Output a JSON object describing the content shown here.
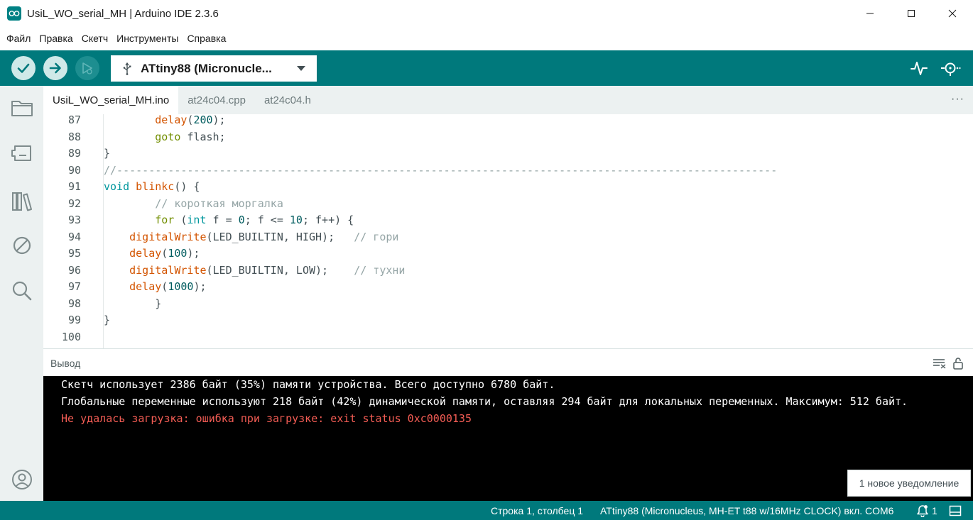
{
  "window": {
    "title": "UsiL_WO_serial_MH | Arduino IDE 2.3.6"
  },
  "menu": [
    "Файл",
    "Правка",
    "Скетч",
    "Инструменты",
    "Справка"
  ],
  "toolbar": {
    "board": "ATtiny88 (Micronucle...",
    "icons": [
      "verify-icon",
      "upload-icon",
      "debug-icon",
      "usb-icon",
      "chevron-down-icon",
      "serial-plotter-icon",
      "serial-monitor-icon"
    ]
  },
  "sidebar": {
    "icons": [
      "folder-icon",
      "boards-manager-icon",
      "library-icon",
      "debug-disabled-icon",
      "search-icon",
      "account-icon"
    ]
  },
  "tabs": {
    "items": [
      "UsiL_WO_serial_MH.ino",
      "at24c04.cpp",
      "at24c04.h"
    ],
    "active": "UsiL_WO_serial_MH.ino",
    "more": "···"
  },
  "editor": {
    "lines": [
      {
        "n": "87",
        "text": "        delay(200);"
      },
      {
        "n": "88",
        "text": "        goto flash;"
      },
      {
        "n": "89",
        "text": "}"
      },
      {
        "n": "90",
        "text": "//-------------------------------------------------------------------------------------------------------"
      },
      {
        "n": "91",
        "text": "void blinkc() {"
      },
      {
        "n": "92",
        "text": "        // короткая моргалка"
      },
      {
        "n": "93",
        "text": "        for (int f = 0; f <= 10; f++) {"
      },
      {
        "n": "94",
        "text": "    digitalWrite(LED_BUILTIN, HIGH);   // гори"
      },
      {
        "n": "95",
        "text": "    delay(100);"
      },
      {
        "n": "96",
        "text": "    digitalWrite(LED_BUILTIN, LOW);    // тухни"
      },
      {
        "n": "97",
        "text": "    delay(1000);"
      },
      {
        "n": "98",
        "text": "        }"
      },
      {
        "n": "99",
        "text": "}"
      },
      {
        "n": "100",
        "text": ""
      }
    ]
  },
  "output": {
    "title": "Вывод",
    "lines": [
      {
        "text": "Скетч использует 2386 байт (35%) памяти устройства. Всего доступно 6780 байт.",
        "kind": "info"
      },
      {
        "text": "Глобальные переменные используют 218 байт (42%) динамической памяти, оставляя 294 байт для локальных переменных. Максимум: 512 байт.",
        "kind": "info"
      },
      {
        "text": "Не удалась загрузка: ошибка при загрузке: exit status 0xc0000135",
        "kind": "error"
      }
    ]
  },
  "notification": {
    "text": "1 новое уведомление"
  },
  "status": {
    "position": "Строка 1, столбец 1",
    "board": "ATtiny88 (Micronucleus, MH-ET t88 w/16MHz CLOCK) вкл. COM6",
    "notifications_count": "1"
  },
  "colors": {
    "accent": "#00797c",
    "sidebar": "#ecf1f1",
    "keyword": "#00979d",
    "function": "#d35400",
    "comment": "#95a5a6",
    "number": "#005c5f",
    "control": "#728e00",
    "error_text": "#f25c54"
  }
}
